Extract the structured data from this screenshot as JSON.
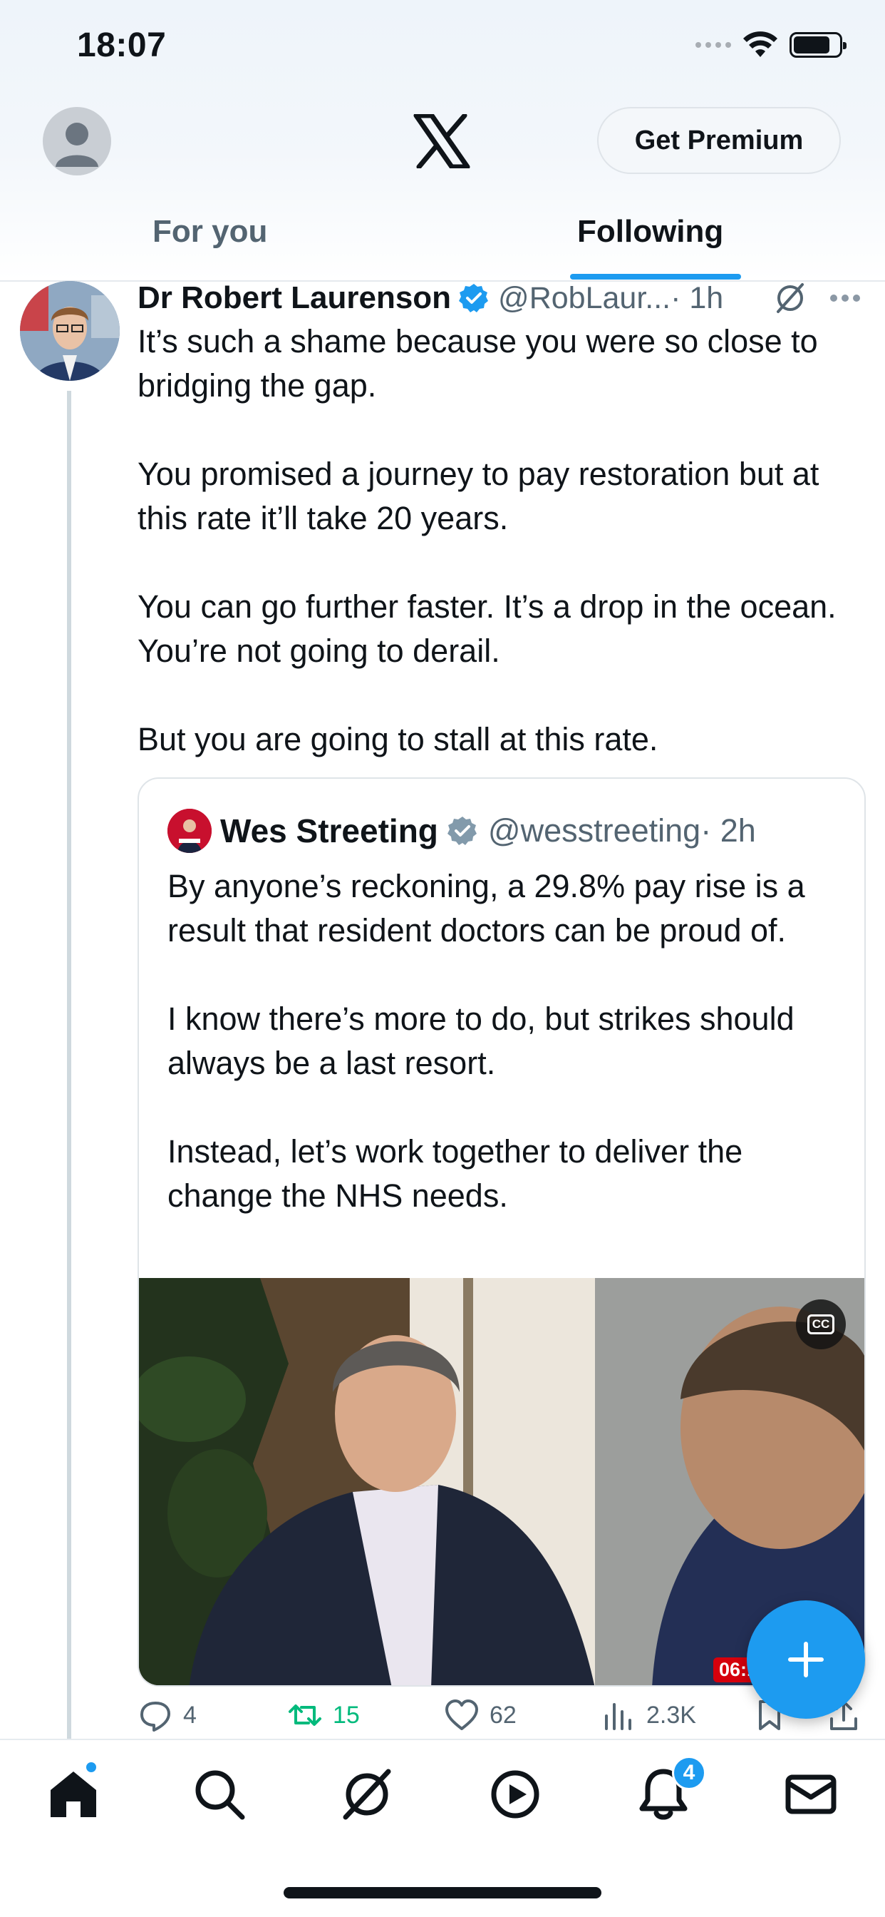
{
  "status_bar": {
    "time": "18:07"
  },
  "header": {
    "premium_label": "Get Premium",
    "tabs": [
      {
        "label": "For you",
        "active": false
      },
      {
        "label": "Following",
        "active": true
      }
    ]
  },
  "post": {
    "author": "Dr Robert Laurenson",
    "handle": "@RobLaur...",
    "time": "· 1h",
    "body": "It’s such a shame because you were so close to bridging the gap.\n\nYou promised a journey to pay restoration but at this rate it’ll take 20 years.\n\nYou can go further faster. It’s a drop in the ocean. You’re not going to derail.\n\nBut you are going to stall at this rate.",
    "quote": {
      "author": "Wes Streeting",
      "handle": "@wesstreeting",
      "time": "· 2h",
      "body": "By anyone’s reckoning, a 29.8% pay rise is a result that resident doctors can be proud of.\n\nI know there’s more to do, but strikes should always be a last resort.\n\nInstead, let’s work together to deliver the change the NHS needs.",
      "video_duration": "06:1"
    },
    "actions": {
      "replies": "4",
      "reposts": "15",
      "likes": "62",
      "views": "2.3K"
    }
  },
  "tabbar": {
    "notifications_badge": "4"
  },
  "colors": {
    "accent": "#1d9bf0",
    "repost": "#00ba7c",
    "muted": "#536471",
    "text": "#0f1419"
  }
}
